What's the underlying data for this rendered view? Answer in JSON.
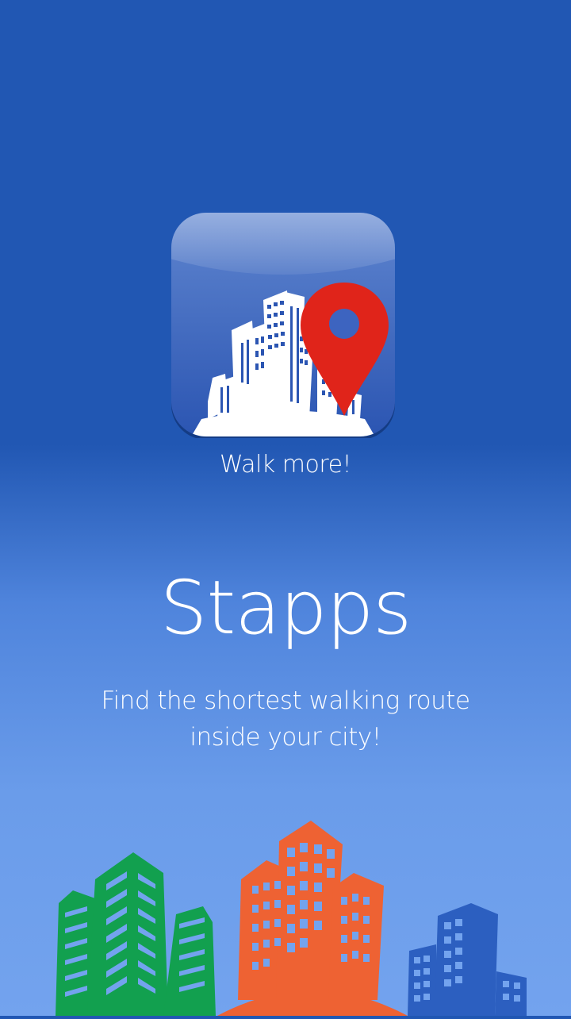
{
  "app": {
    "icon_name": "city-location-pin-icon",
    "tagline": "Walk more!",
    "name": "Stapps",
    "description": "Find the shortest walking route inside your city!"
  },
  "colors": {
    "background_top": "#2157b3",
    "background_bottom": "#73a3ee",
    "pin_red": "#e0241a",
    "green_buildings": "#12a04f",
    "orange_buildings": "#ee6233",
    "blue_buildings": "#2c5fc0"
  },
  "illustration": {
    "name": "city-skyline-illustration"
  }
}
